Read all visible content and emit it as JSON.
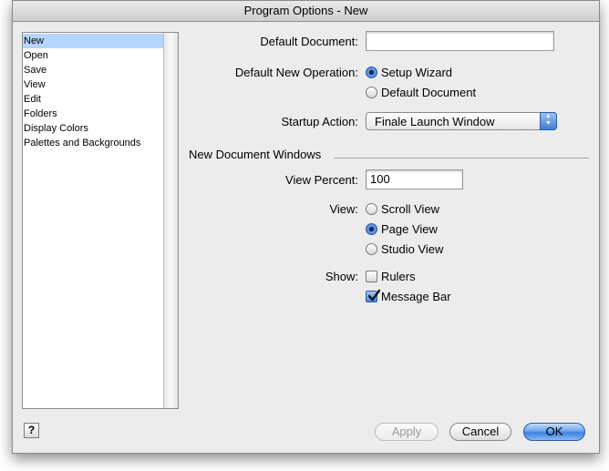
{
  "window": {
    "title": "Program Options - New"
  },
  "sidebar": {
    "items": [
      {
        "label": "New",
        "selected": true
      },
      {
        "label": "Open"
      },
      {
        "label": "Save"
      },
      {
        "label": "View"
      },
      {
        "label": "Edit"
      },
      {
        "label": "Folders"
      },
      {
        "label": "Display Colors"
      },
      {
        "label": "Palettes and Backgrounds"
      }
    ]
  },
  "form": {
    "default_document": {
      "label": "Default Document:",
      "value": ""
    },
    "default_new_operation": {
      "label": "Default New Operation:",
      "options": [
        {
          "label": "Setup Wizard",
          "selected": true
        },
        {
          "label": "Default Document",
          "selected": false
        }
      ]
    },
    "startup_action": {
      "label": "Startup Action:",
      "value": "Finale Launch Window"
    },
    "section_title": "New Document Windows",
    "view_percent": {
      "label": "View Percent:",
      "value": "100"
    },
    "view": {
      "label": "View:",
      "options": [
        {
          "label": "Scroll View",
          "selected": false
        },
        {
          "label": "Page View",
          "selected": true
        },
        {
          "label": "Studio View",
          "selected": false
        }
      ]
    },
    "show": {
      "label": "Show:",
      "options": [
        {
          "label": "Rulers",
          "checked": false
        },
        {
          "label": "Message Bar",
          "checked": true
        }
      ]
    }
  },
  "buttons": {
    "help": "?",
    "apply": "Apply",
    "cancel": "Cancel",
    "ok": "OK"
  },
  "colors": {
    "selection": "#b5d5ff",
    "accent": "#3d82e0"
  }
}
